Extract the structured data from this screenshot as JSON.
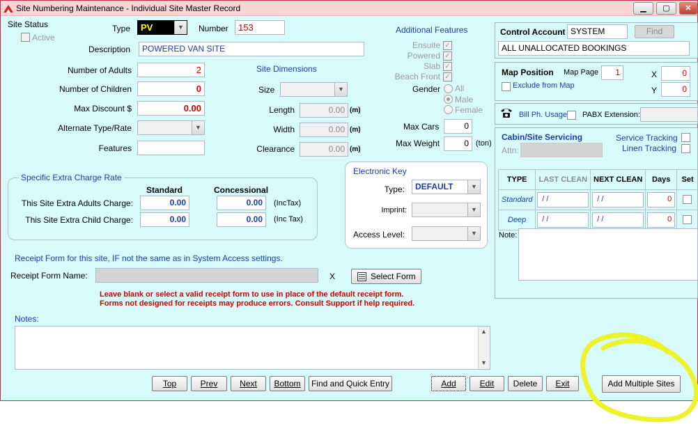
{
  "window": {
    "title": "Site Numbering Maintenance - Individual Site Master Record",
    "minimize": "▁",
    "maximize": "▢",
    "close": "✕"
  },
  "site_status": {
    "label": "Site Status",
    "active_label": "Active"
  },
  "type": {
    "label": "Type",
    "value": "PV"
  },
  "number": {
    "label": "Number",
    "value": "153"
  },
  "description": {
    "label": "Description",
    "value": "POWERED VAN SITE"
  },
  "adults": {
    "label": "Number of Adults",
    "value": "2"
  },
  "children": {
    "label": "Number of Children",
    "value": "0"
  },
  "max_discount": {
    "label": "Max Discount $",
    "value": "0.00"
  },
  "alt_type": {
    "label": "Alternate Type/Rate",
    "value": ""
  },
  "features": {
    "label": "Features",
    "value": ""
  },
  "site_dimensions": {
    "title": "Site Dimensions",
    "size_label": "Size",
    "length_label": "Length",
    "length_value": "0.00",
    "width_label": "Width",
    "width_value": "0.00",
    "clearance_label": "Clearance",
    "clearance_value": "0.00",
    "unit": "(m)"
  },
  "additional_features": {
    "title": "Additional Features",
    "ensuite": "Ensuite",
    "powered": "Powered",
    "slab": "Slab",
    "beach_front": "Beach Front",
    "check_mark": "✓",
    "gender_label": "Gender",
    "gender_all": "All",
    "gender_male": "Male",
    "gender_female": "Female",
    "max_cars_label": "Max Cars",
    "max_cars_value": "0",
    "max_weight_label": "Max Weight",
    "max_weight_value": "0",
    "max_weight_unit": "(ton)"
  },
  "extra_charge": {
    "title": "Specific Extra Charge Rate",
    "standard": "Standard",
    "concessional": "Concessional",
    "adults_label": "This Site Extra Adults Charge:",
    "adults_std": "0.00",
    "adults_conc": "0.00",
    "adults_tax": "(IncTax)",
    "child_label": "This Site Extra Child Charge:",
    "child_std": "0.00",
    "child_conc": "0.00",
    "child_tax": "(Inc Tax)"
  },
  "electronic_key": {
    "title": "Electronic Key",
    "type_label": "Type:",
    "type_value": "DEFAULT",
    "imprint_label": "Imprint:",
    "access_label": "Access Level:"
  },
  "receipt": {
    "heading": "Receipt Form  for this site, IF not the same as in System Access settings.",
    "name_label": "Receipt Form Name:",
    "clear": "X",
    "select_button": "Select Form",
    "warning1": "Leave blank or select a valid receipt form to use in place of the default receipt form.",
    "warning2": "Forms not designed for receipts may produce errors. Consult Support if help required."
  },
  "notes_label": "Notes:",
  "control_account": {
    "label": "Control Account",
    "value": "SYSTEM",
    "find_button": "Find",
    "description": "ALL UNALLOCATED BOOKINGS"
  },
  "map_position": {
    "label": "Map Position",
    "page_label": "Map Page",
    "page_value": "1",
    "x_label": "X",
    "x_value": "0",
    "y_label": "Y",
    "y_value": "0",
    "exclude_label": "Exclude from Map"
  },
  "phone": {
    "bill_label": "Bill Ph. Usage",
    "pabx_label": "PABX Extension:"
  },
  "servicing": {
    "title": "Cabin/Site Servicing",
    "attn_label": "Attn:",
    "service_tracking": "Service Tracking",
    "linen_tracking": "Linen Tracking",
    "headers": [
      "TYPE",
      "LAST CLEAN",
      "NEXT CLEAN",
      "Days",
      "Set"
    ],
    "rows": [
      {
        "type": "Standard",
        "last": " / /",
        "next": " / /",
        "days": "0"
      },
      {
        "type": "Deep",
        "last": " / /",
        "next": " / /",
        "days": "0"
      }
    ],
    "note_label": "Note:"
  },
  "nav": {
    "top": "Top",
    "prev": "Prev",
    "next": "Next",
    "bottom": "Bottom",
    "find_quick": "Find and Quick Entry",
    "add": "Add",
    "edit": "Edit",
    "delete": "Delete",
    "exit": "Exit",
    "add_multiple": "Add Multiple Sites"
  },
  "scroll": {
    "up": "▲",
    "down": "▼"
  },
  "combo_arrow": "▼",
  "colors": {
    "highlight_annotation": "#eef22a",
    "accent_red": "#cc0000",
    "label_blue": "#1a3cb0"
  }
}
